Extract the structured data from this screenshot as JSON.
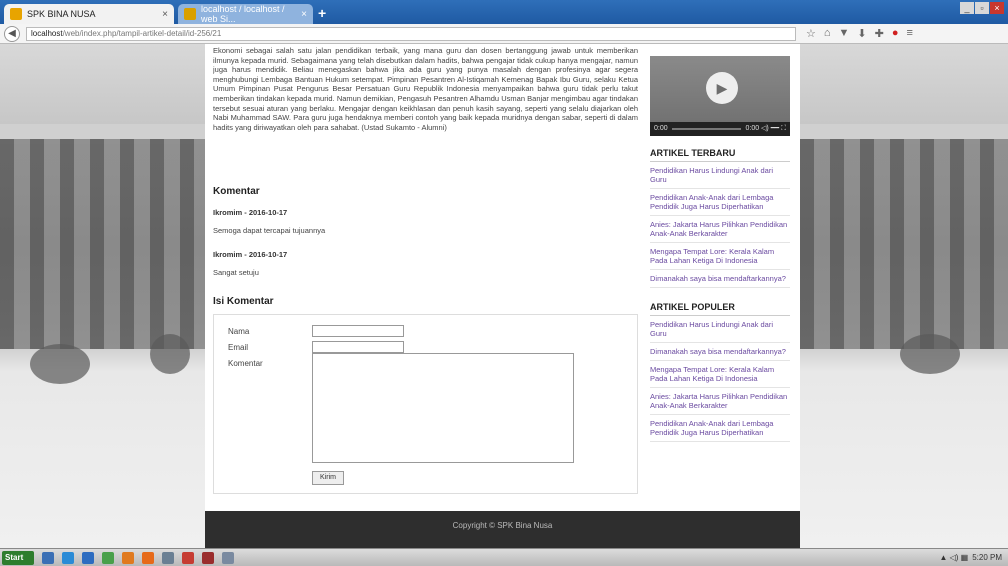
{
  "browser": {
    "tabs": [
      {
        "label": "SPK BINA NUSA",
        "close": "×"
      },
      {
        "label": "localhost / localhost / web Si...",
        "close": "×"
      }
    ],
    "new_tab": "+",
    "url_host": "localhost",
    "url_path": "/web/index.php/tampil-artikel-detail/id-256/21",
    "window_controls": [
      "_",
      "▫",
      "×"
    ],
    "nav_icons": [
      "☆",
      "⌂",
      "▼",
      "⬇",
      "✚",
      "●",
      "≡"
    ]
  },
  "article": {
    "body": "Ekonomi sebagai salah satu jalan pendidikan terbaik, yang mana guru dan dosen bertanggung jawab untuk memberikan ilmunya kepada murid. Sebagaimana yang telah disebutkan dalam hadits, bahwa pengajar tidak cukup hanya mengajar, namun juga harus mendidik. Beliau menegaskan bahwa jika ada guru yang punya masalah dengan profesinya agar segera menghubungi Lembaga Bantuan Hukum setempat. Pimpinan Pesantren Al-Istiqamah Kemenag Bapak Ibu Guru, selaku Ketua Umum Pimpinan Pusat Pengurus Besar Persatuan Guru Republik Indonesia menyampaikan bahwa guru tidak perlu takut memberikan tindakan kepada murid. Namun demikian, Pengasuh Pesantren Alhamdu Usman Banjar mengimbau agar tindakan tersebut sesuai aturan yang berlaku. Mengajar dengan keikhlasan dan penuh kasih sayang, seperti yang selalu diajarkan oleh Nabi Muhammad SAW. Para guru juga hendaknya memberi contoh yang baik kepada muridnya dengan sabar, seperti di dalam hadits yang diriwayatkan oleh para sahabat. (Ustad Sukamto - Alumni)",
    "comments_title": "Komentar",
    "comments": [
      {
        "meta": "Ikromim - 2016-10-17",
        "text": "Semoga dapat tercapai tujuannya"
      },
      {
        "meta": "Ikromim - 2016-10-17",
        "text": "Sangat setuju"
      }
    ],
    "form_title": "Isi Komentar",
    "form": {
      "name_label": "Nama",
      "email_label": "Email",
      "comment_label": "Komentar",
      "submit_label": "Kirim"
    }
  },
  "video": {
    "play": "▶",
    "time": "0:00",
    "duration": "0:00 ◁) ━━ ⛶"
  },
  "sidebar": {
    "latest_title": "ARTIKEL TERBARU",
    "latest": [
      "Pendidikan Harus Lindungi Anak dari Guru",
      "Pendidikan Anak-Anak dari Lembaga Pendidik Juga Harus Diperhatikan",
      "Anies: Jakarta Harus Pilihkan Pendidikan Anak-Anak Berkarakter",
      "Mengapa Tempat Lore: Kerala Kalam Pada Lahan Ketiga Di Indonesia",
      "Dimanakah saya bisa mendaftarkannya?"
    ],
    "popular_title": "ARTIKEL POPULER",
    "popular": [
      "Pendidikan Harus Lindungi Anak dari Guru",
      "Dimanakah saya bisa mendaftarkannya?",
      "Mengapa Tempat Lore: Kerala Kalam Pada Lahan Ketiga Di Indonesia",
      "Anies: Jakarta Harus Pilihkan Pendidikan Anak-Anak Berkarakter",
      "Pendidikan Anak-Anak dari Lembaga Pendidik Juga Harus Diperhatikan"
    ]
  },
  "footer": {
    "text": "Copyright © SPK Bina Nusa"
  },
  "taskbar": {
    "start": "Start",
    "time": "5:20 PM",
    "tray": "▲ ◁) ▦"
  }
}
